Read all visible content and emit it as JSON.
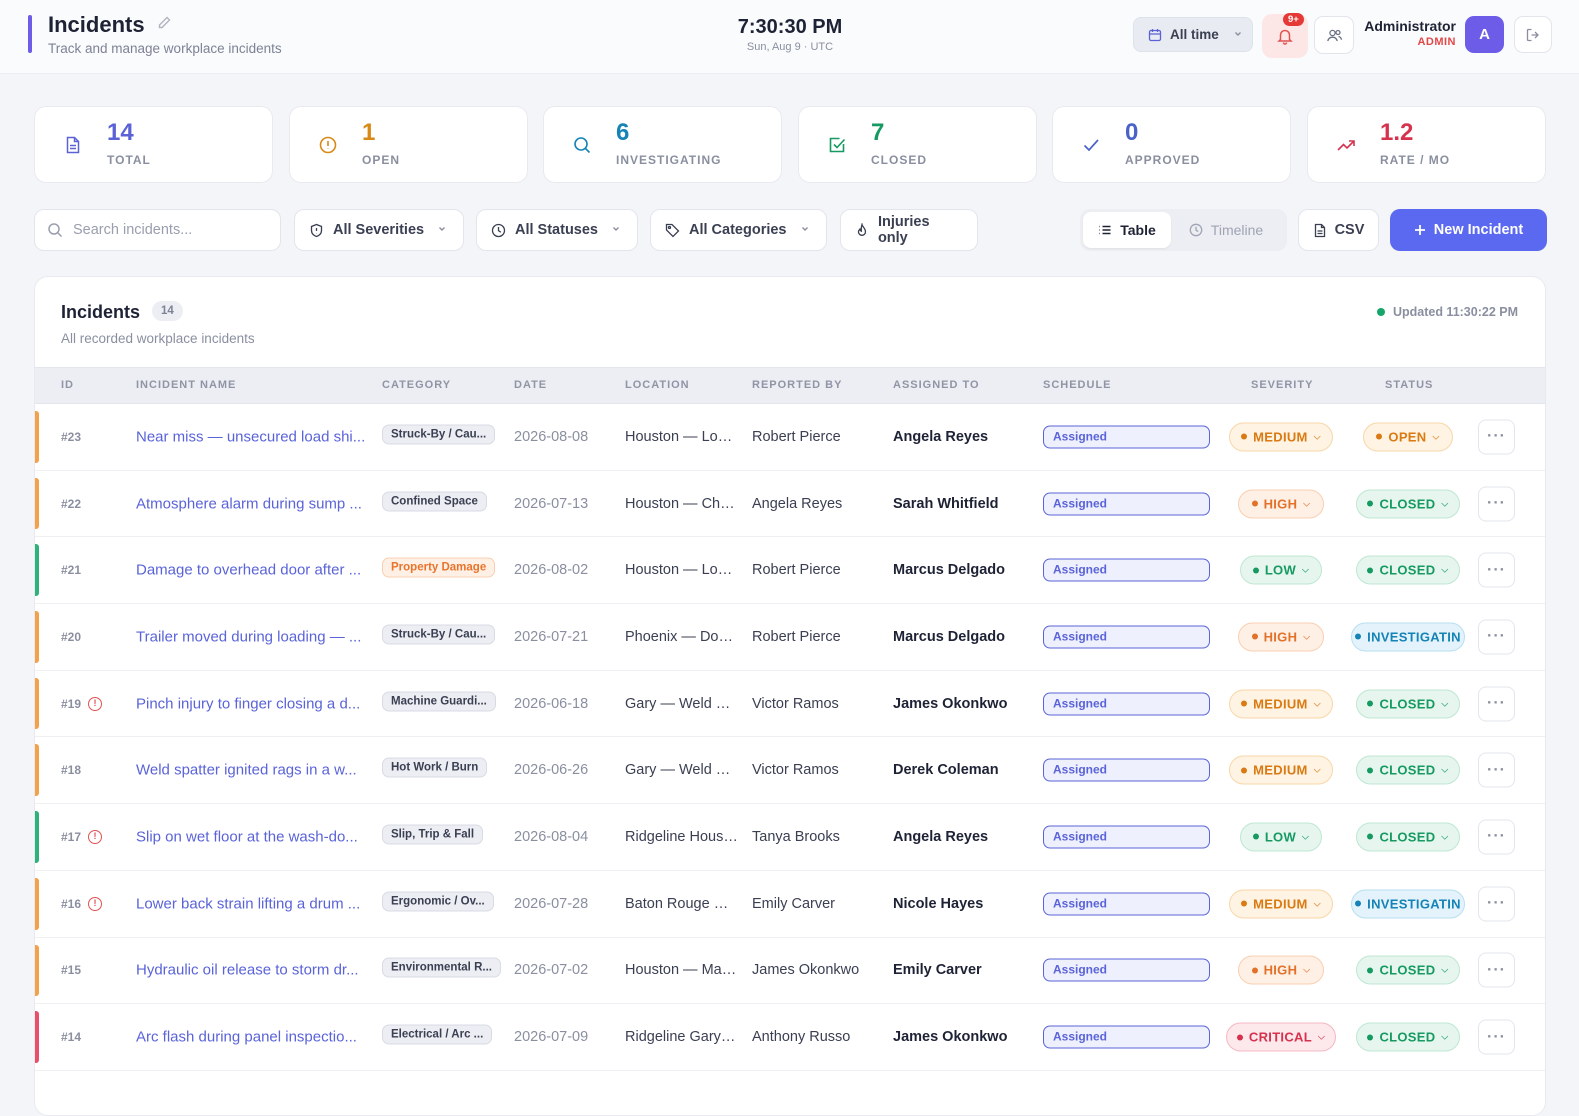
{
  "header": {
    "title": "Incidents",
    "subtitle": "Track and manage workplace incidents",
    "clock_time": "7:30:30 PM",
    "clock_date": "Sun, Aug 9 · UTC",
    "time_filter": "All time",
    "notif_badge": "9+",
    "user_name": "Administrator",
    "user_role": "ADMIN",
    "avatar_initial": "A"
  },
  "stats": [
    {
      "value": "14",
      "label": "TOTAL",
      "icon": "document-icon",
      "color": "#5b62d6"
    },
    {
      "value": "1",
      "label": "OPEN",
      "icon": "alert-circle-icon",
      "color": "#d98a16"
    },
    {
      "value": "6",
      "label": "INVESTIGATING",
      "icon": "search-icon",
      "color": "#1583b5"
    },
    {
      "value": "7",
      "label": "CLOSED",
      "icon": "check-square-icon",
      "color": "#169a62"
    },
    {
      "value": "0",
      "label": "APPROVED",
      "icon": "check-icon",
      "color": "#4a62c9"
    },
    {
      "value": "1.2",
      "label": "RATE / MO",
      "icon": "trend-up-icon",
      "color": "#d6324e"
    }
  ],
  "filters": {
    "search_placeholder": "Search incidents...",
    "severity": "All Severities",
    "status": "All Statuses",
    "category": "All Categories",
    "injuries": "Injuries only",
    "view_table": "Table",
    "view_timeline": "Timeline",
    "csv": "CSV",
    "new_incident": "New Incident"
  },
  "table": {
    "title": "Incidents",
    "count": "14",
    "subtitle": "All recorded workplace incidents",
    "updated": "Updated 11:30:22 PM",
    "columns": [
      "ID",
      "INCIDENT NAME",
      "CATEGORY",
      "DATE",
      "LOCATION",
      "REPORTED BY",
      "ASSIGNED TO",
      "SCHEDULE",
      "SEVERITY",
      "STATUS"
    ],
    "rows": [
      {
        "id": "#23",
        "alert": false,
        "name": "Near miss — unsecured load shi...",
        "category": "Struck-By / Cau...",
        "category_warn": false,
        "date": "2026-08-08",
        "location": "Houston — Load...",
        "reported_by": "Robert Pierce",
        "assigned_to": "Angela Reyes",
        "schedule": "Assigned",
        "severity": "MEDIUM",
        "status": "OPEN"
      },
      {
        "id": "#22",
        "alert": false,
        "name": "Atmosphere alarm during sump ...",
        "category": "Confined Space",
        "category_warn": false,
        "date": "2026-07-13",
        "location": "Houston — Che...",
        "reported_by": "Angela Reyes",
        "assigned_to": "Sarah Whitfield",
        "schedule": "Assigned",
        "severity": "HIGH",
        "status": "CLOSED"
      },
      {
        "id": "#21",
        "alert": false,
        "name": "Damage to overhead door after ...",
        "category": "Property Damage",
        "category_warn": true,
        "date": "2026-08-02",
        "location": "Houston — Load...",
        "reported_by": "Robert Pierce",
        "assigned_to": "Marcus Delgado",
        "schedule": "Assigned",
        "severity": "LOW",
        "status": "CLOSED"
      },
      {
        "id": "#20",
        "alert": false,
        "name": "Trailer moved during loading — ...",
        "category": "Struck-By / Cau...",
        "category_warn": false,
        "date": "2026-07-21",
        "location": "Phoenix — Dock ...",
        "reported_by": "Robert Pierce",
        "assigned_to": "Marcus Delgado",
        "schedule": "Assigned",
        "severity": "HIGH",
        "status": "INVESTIGATIN"
      },
      {
        "id": "#19",
        "alert": true,
        "name": "Pinch injury to finger closing a d...",
        "category": "Machine Guardi...",
        "category_warn": false,
        "date": "2026-06-18",
        "location": "Gary — Weld Ba...",
        "reported_by": "Victor Ramos",
        "assigned_to": "James Okonkwo",
        "schedule": "Assigned",
        "severity": "MEDIUM",
        "status": "CLOSED"
      },
      {
        "id": "#18",
        "alert": false,
        "name": "Weld spatter ignited rags in a w...",
        "category": "Hot Work / Burn",
        "category_warn": false,
        "date": "2026-06-26",
        "location": "Gary — Weld Ba...",
        "reported_by": "Victor Ramos",
        "assigned_to": "Derek Coleman",
        "schedule": "Assigned",
        "severity": "MEDIUM",
        "status": "CLOSED"
      },
      {
        "id": "#17",
        "alert": true,
        "name": "Slip on wet floor at the wash-do...",
        "category": "Slip, Trip & Fall",
        "category_warn": false,
        "date": "2026-08-04",
        "location": "Ridgeline Housto...",
        "reported_by": "Tanya Brooks",
        "assigned_to": "Angela Reyes",
        "schedule": "Assigned",
        "severity": "LOW",
        "status": "CLOSED"
      },
      {
        "id": "#16",
        "alert": true,
        "name": "Lower back strain lifting a drum ...",
        "category": "Ergonomic / Ov...",
        "category_warn": false,
        "date": "2026-07-28",
        "location": "Baton Rouge — ...",
        "reported_by": "Emily Carver",
        "assigned_to": "Nicole Hayes",
        "schedule": "Assigned",
        "severity": "MEDIUM",
        "status": "INVESTIGATIN"
      },
      {
        "id": "#15",
        "alert": false,
        "name": "Hydraulic oil release to storm dr...",
        "category": "Environmental R...",
        "category_warn": false,
        "date": "2026-07-02",
        "location": "Houston — Main...",
        "reported_by": "James Okonkwo",
        "assigned_to": "Emily Carver",
        "schedule": "Assigned",
        "severity": "HIGH",
        "status": "CLOSED"
      },
      {
        "id": "#14",
        "alert": false,
        "name": "Arc flash during panel inspectio...",
        "category": "Electrical / Arc ...",
        "category_warn": false,
        "date": "2026-07-09",
        "location": "Ridgeline Gary F...",
        "reported_by": "Anthony Russo",
        "assigned_to": "James Okonkwo",
        "schedule": "Assigned",
        "severity": "CRITICAL",
        "status": "CLOSED"
      }
    ]
  },
  "colors": {
    "accent": "#5b68f0",
    "severity": {
      "LOW": {
        "fg": "#169a62",
        "bg": "#e6f6ee",
        "border": "#bfe7d2",
        "stripe": "#2fb27a"
      },
      "MEDIUM": {
        "fg": "#d97a12",
        "bg": "#fff3e3",
        "border": "#f8d7a8",
        "stripe": "#f4a24a"
      },
      "HIGH": {
        "fg": "#e2712a",
        "bg": "#fff0e6",
        "border": "#f9cfb1",
        "stripe": "#f4a24a"
      },
      "CRITICAL": {
        "fg": "#d6324e",
        "bg": "#fde8ec",
        "border": "#f4b8c3",
        "stripe": "#e8506a"
      }
    },
    "status": {
      "OPEN": {
        "fg": "#d97a12",
        "bg": "#fff3e3",
        "border": "#f8d7a8"
      },
      "CLOSED": {
        "fg": "#169a62",
        "bg": "#e6f6ee",
        "border": "#bfe7d2"
      },
      "INVESTIGATIN": {
        "fg": "#1583b5",
        "bg": "#e4f3fb",
        "border": "#b8dff1"
      }
    }
  }
}
